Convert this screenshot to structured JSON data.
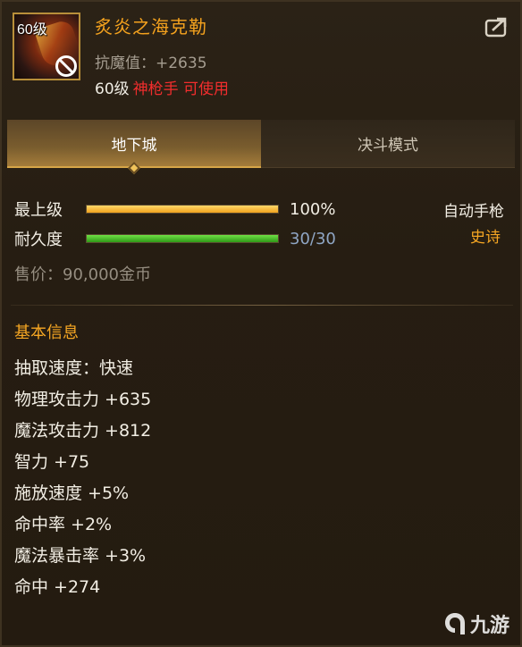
{
  "item": {
    "level_tag": "60级",
    "name": "炙炎之海克勒",
    "resist_text": "抗魔值：+2635",
    "req_level": "60级",
    "req_class": "神枪手 可使用"
  },
  "tabs": [
    {
      "label": "地下城",
      "active": true
    },
    {
      "label": "决斗模式",
      "active": false
    }
  ],
  "bars": {
    "upgrade": {
      "label": "最上级",
      "value_text": "100%",
      "fraction": 1.0
    },
    "durability": {
      "label": "耐久度",
      "value_text": "30/30",
      "fraction": 1.0
    }
  },
  "weapon_type": "自动手枪",
  "rarity": "史诗",
  "price": "售价：90,000金币",
  "section_title": "基本信息",
  "attributes": [
    "抽取速度：快速",
    "物理攻击力 +635",
    "魔法攻击力 +812",
    "智力 +75",
    "施放速度 +5%",
    "命中率 +2%",
    "魔法暴击率 +3%",
    "命中 +274"
  ],
  "watermark": {
    "text": "九游",
    "icon": "jiuyou-logo-icon"
  },
  "icons": {
    "share": "share-icon",
    "forbid": "forbid-icon",
    "tab_indicator": "diamond-icon"
  },
  "colors": {
    "name": "#f4a21e",
    "class_req": "#f22d2d",
    "rarity": "#f5a623",
    "upgrade_bar": "#f0a21d",
    "durability_bar": "#2f9a17"
  }
}
